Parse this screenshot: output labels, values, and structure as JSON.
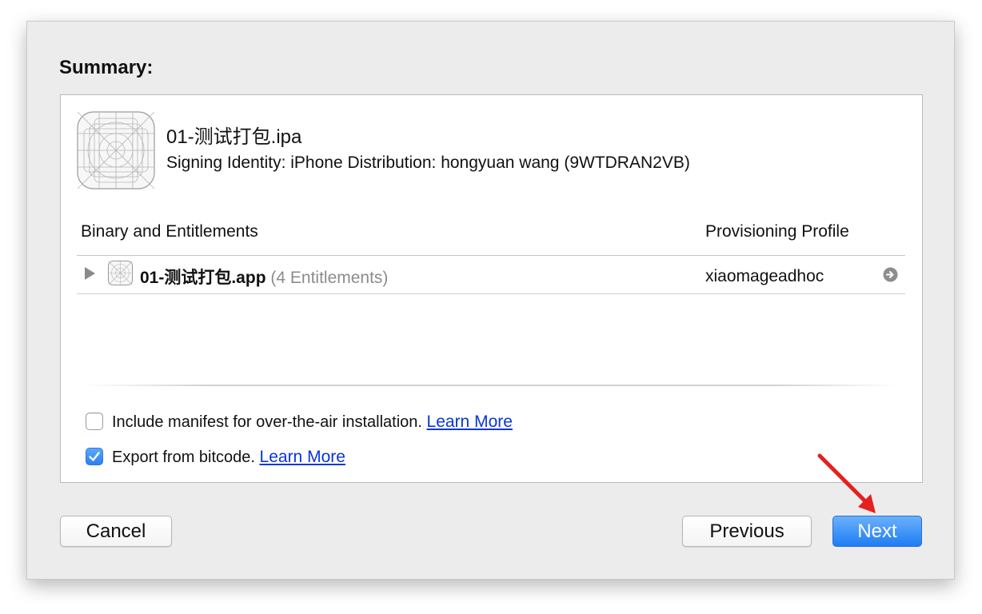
{
  "summary": {
    "title": "Summary:"
  },
  "ipa": {
    "name": "01-测试打包.ipa",
    "signing_identity": "Signing Identity: iPhone Distribution: hongyuan wang (9WTDRAN2VB)"
  },
  "table": {
    "headers": {
      "binary": "Binary and Entitlements",
      "profile": "Provisioning Profile"
    },
    "rows": [
      {
        "app_name": "01-测试打包.app",
        "entitlements": "(4 Entitlements)",
        "profile": "xiaomageadhoc"
      }
    ]
  },
  "options": [
    {
      "label": "Include manifest for over-the-air installation.",
      "link": "Learn More",
      "checked": false
    },
    {
      "label": "Export from bitcode.",
      "link": "Learn More",
      "checked": true
    }
  ],
  "buttons": {
    "cancel": "Cancel",
    "previous": "Previous",
    "next": "Next"
  },
  "colors": {
    "accent": "#1f7df3",
    "link": "#0a35d8",
    "annotation_arrow": "#e5201f"
  }
}
